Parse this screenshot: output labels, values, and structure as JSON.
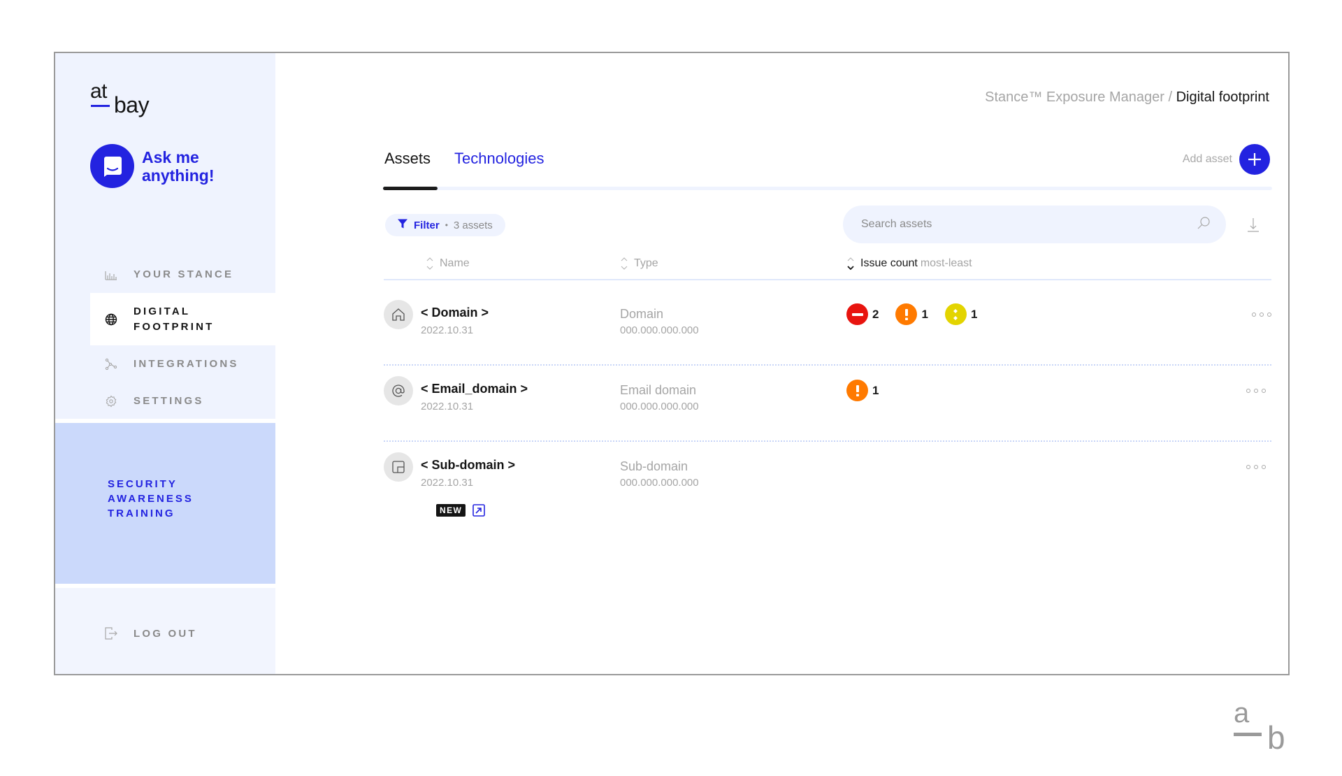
{
  "brand": {
    "logo_top": "at",
    "logo_bottom": "bay",
    "accent": "#2323e0"
  },
  "assistant": {
    "label": "Ask me anything!",
    "icon": "chat-smile-icon"
  },
  "sidebar": {
    "items": [
      {
        "label": "YOUR STANCE",
        "icon": "bar-chart-icon",
        "active": false
      },
      {
        "label": "DIGITAL FOOTPRINT",
        "icon": "globe-icon",
        "active": true
      },
      {
        "label": "INTEGRATIONS",
        "icon": "nodes-icon",
        "active": false
      },
      {
        "label": "SETTINGS",
        "icon": "gear-icon",
        "active": false
      }
    ],
    "promo": {
      "badge": "NEW",
      "title": "SECURITY AWARENESS TRAINING",
      "icon": "external-link-icon"
    },
    "logout": {
      "label": "LOG OUT",
      "icon": "logout-icon"
    }
  },
  "breadcrumb": {
    "parent": "Stance™ Exposure Manager",
    "separator": " / ",
    "current": "Digital footprint"
  },
  "tabs": [
    {
      "label": "Assets",
      "active": true
    },
    {
      "label": "Technologies",
      "active": false
    }
  ],
  "add_asset": {
    "label": "Add asset"
  },
  "filter": {
    "label": "Filter",
    "separator": "•",
    "count": "3 assets"
  },
  "search": {
    "placeholder": "Search assets",
    "value": ""
  },
  "table": {
    "columns": {
      "name": "Name",
      "type": "Type",
      "issues": "Issue count",
      "issues_sort": "most-least"
    },
    "rows": [
      {
        "name": "< Domain >",
        "date": "2022.10.31",
        "type": "Domain",
        "ip": "000.000.000.000",
        "icon": "home-icon",
        "issues": [
          {
            "severity": "critical",
            "icon": "minus-icon",
            "color": "#e8140f",
            "count": "2"
          },
          {
            "severity": "high",
            "icon": "exclamation-icon",
            "color": "#ff7a00",
            "count": "1"
          },
          {
            "severity": "medium",
            "icon": "colon-icon",
            "color": "#e3d400",
            "count": "1"
          }
        ]
      },
      {
        "name": "< Email_domain >",
        "date": "2022.10.31",
        "type": "Email domain",
        "ip": "000.000.000.000",
        "icon": "at-icon",
        "issues": [
          {
            "severity": "high",
            "icon": "exclamation-icon",
            "color": "#ff7a00",
            "count": "1"
          }
        ]
      },
      {
        "name": "< Sub-domain >",
        "date": "2022.10.31",
        "type": "Sub-domain",
        "ip": "000.000.000.000",
        "icon": "subdomain-icon",
        "issues": []
      }
    ]
  },
  "watermark": {
    "top": "a",
    "bottom": "b"
  }
}
